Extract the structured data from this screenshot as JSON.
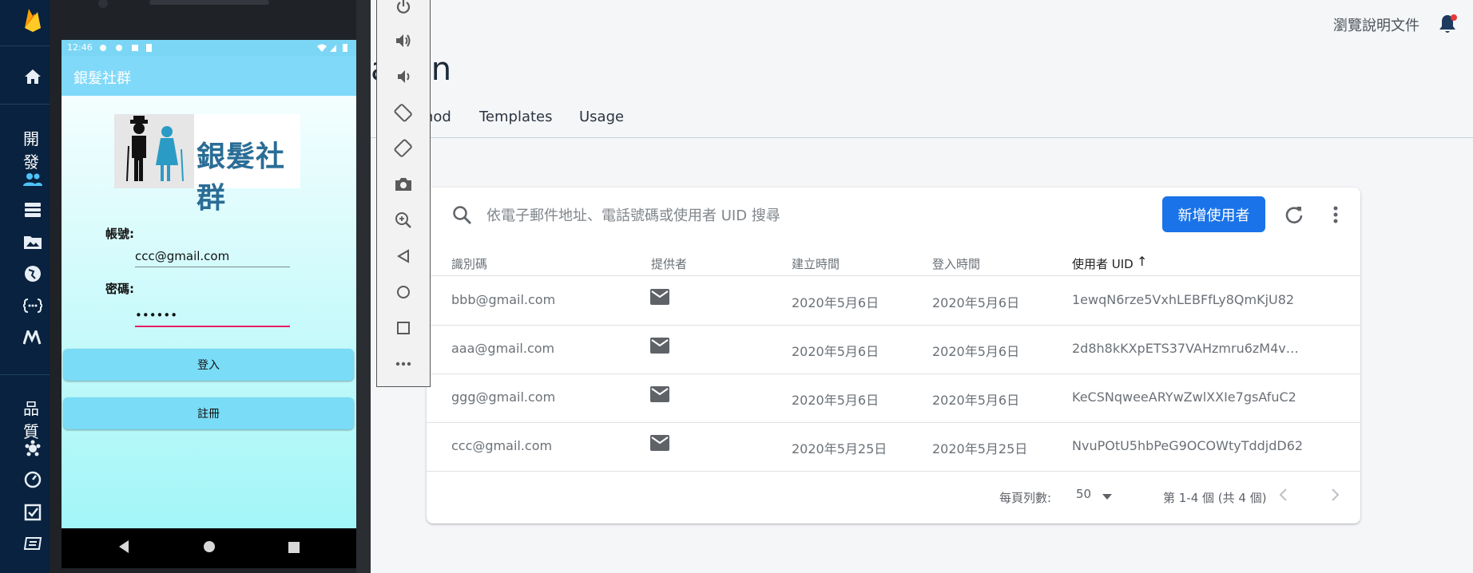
{
  "firebase": {
    "sidebar": {
      "section_build": "開發",
      "section_quality": "品質"
    },
    "topbar": {
      "docs_link": "瀏覽說明文件"
    },
    "page_title_visible": "ation",
    "tabs": [
      "Sign-in method",
      "Templates",
      "Usage"
    ],
    "tab_visible_fragment": "hod",
    "search": {
      "placeholder": "依電子郵件地址、電話號碼或使用者 UID 搜尋"
    },
    "add_user_label": "新增使用者",
    "table": {
      "headers": [
        "識別碼",
        "提供者",
        "建立時間",
        "登入時間",
        "使用者 UID"
      ],
      "sort_indicator": "↑",
      "rows": [
        {
          "id": "bbb@gmail.com",
          "provider": "email",
          "created": "2020年5月6日",
          "signed_in": "2020年5月6日",
          "uid": "1ewqN6rze5VxhLEBFfLy8QmKjU82"
        },
        {
          "id": "aaa@gmail.com",
          "provider": "email",
          "created": "2020年5月6日",
          "signed_in": "2020年5月6日",
          "uid": "2d8h8kKXpETS37VAHzmru6zM4v…"
        },
        {
          "id": "ggg@gmail.com",
          "provider": "email",
          "created": "2020年5月6日",
          "signed_in": "2020年5月6日",
          "uid": "KeCSNqweeARYwZwlXXIe7gsAfuC2"
        },
        {
          "id": "ccc@gmail.com",
          "provider": "email",
          "created": "2020年5月25日",
          "signed_in": "2020年5月25日",
          "uid": "NvuPOtU5hbPeG9OCOWtyTddjdD62"
        }
      ]
    },
    "footer": {
      "rows_per_page_label": "每頁列數:",
      "rows_per_page_value": "50",
      "range_label": "第 1-4 個 (共 4 個)"
    }
  },
  "emulator": {
    "status_time": "12:46",
    "app_title": "銀髮社群",
    "logo_text": "銀髮社群",
    "account_label": "帳號:",
    "account_value": "ccc@gmail.com",
    "password_label": "密碼:",
    "password_value": "••••••",
    "login_button": "登入",
    "register_button": "註冊",
    "toolbar_icons": [
      "power-icon",
      "volume-up-icon",
      "volume-down-icon",
      "rotate-left-icon",
      "rotate-right-icon",
      "camera-icon",
      "zoom-icon",
      "back-icon",
      "home-icon",
      "overview-icon",
      "more-icon"
    ]
  },
  "colors": {
    "firebase_nav": "#08223f",
    "primary_button": "#1a73e8",
    "app_bar": "#81d9f9",
    "app_button": "#7adcf6",
    "focus_underline": "#e91e63"
  }
}
